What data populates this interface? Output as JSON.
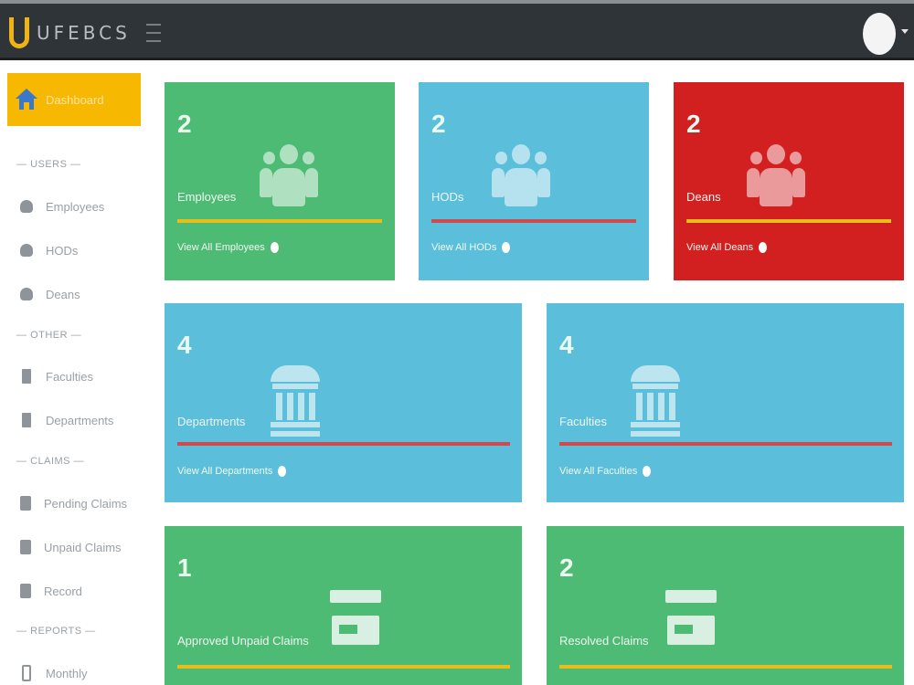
{
  "app": {
    "logo_text": "UFEBCS"
  },
  "sidebar": {
    "dashboard_label": "Dashboard",
    "sections": [
      {
        "label": "USERS",
        "items": [
          {
            "label": "Employees",
            "icon": "user-icon"
          },
          {
            "label": "HODs",
            "icon": "user-icon"
          },
          {
            "label": "Deans",
            "icon": "user-icon"
          }
        ]
      },
      {
        "label": "OTHER",
        "items": [
          {
            "label": "Faculties",
            "icon": "building-icon"
          },
          {
            "label": "Departments",
            "icon": "building-icon"
          }
        ]
      },
      {
        "label": "CLAIMS",
        "items": [
          {
            "label": "Pending Claims",
            "icon": "document-icon"
          },
          {
            "label": "Unpaid Claims",
            "icon": "document-icon"
          },
          {
            "label": "Record",
            "icon": "document-icon"
          }
        ]
      },
      {
        "label": "REPORTS",
        "items": [
          {
            "label": "Monthly",
            "icon": "mobile-icon"
          }
        ]
      }
    ]
  },
  "cards": {
    "employees": {
      "count": "2",
      "label": "Employees",
      "link": "View All Employees",
      "color": "#4dbb73"
    },
    "hods": {
      "count": "2",
      "label": "HODs",
      "link": "View All HODs",
      "color": "#5bbfdb"
    },
    "deans": {
      "count": "2",
      "label": "Deans",
      "link": "View All Deans",
      "color": "#d21f1f"
    },
    "departments": {
      "count": "4",
      "label": "Departments",
      "link": "View All Departments",
      "color": "#5bbfdb"
    },
    "faculties": {
      "count": "4",
      "label": "Faculties",
      "link": "View All Faculties",
      "color": "#5bbfdb"
    },
    "approved_unpaid": {
      "count": "1",
      "label": "Approved Unpaid Claims",
      "color": "#4dbb73"
    },
    "resolved": {
      "count": "2",
      "label": "Resolved Claims",
      "color": "#4dbb73"
    }
  },
  "colors": {
    "topbar": "#2f3439",
    "accent": "#f6b800",
    "rule_gold": "#e9bd1a",
    "rule_red": "#cf4a4f"
  }
}
